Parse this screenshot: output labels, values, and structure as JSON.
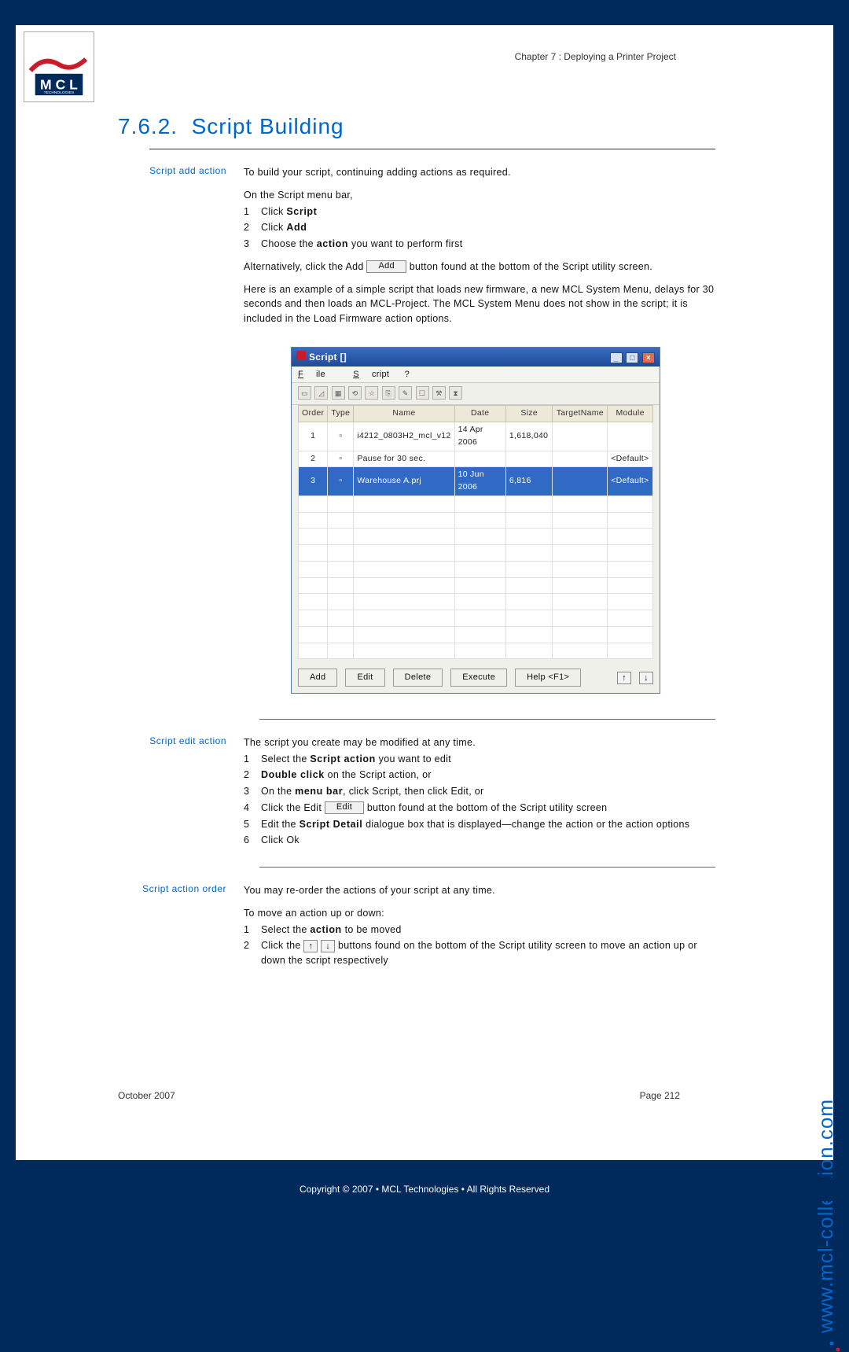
{
  "chapter": "Chapter 7 : Deploying a Printer Project",
  "heading_number": "7.6.2.",
  "heading_title": "Script Building",
  "section1": {
    "label": "Script add action",
    "intro": "To build your script, continuing adding actions as required.",
    "menu_intro": "On the Script menu bar,",
    "steps": [
      {
        "n": "1",
        "pre": "Click ",
        "bold": "Script"
      },
      {
        "n": "2",
        "pre": "Click ",
        "bold": "Add"
      },
      {
        "n": "3",
        "pre": "Choose the ",
        "bold": "action",
        "post": " you want to perform first"
      }
    ],
    "alt_pre": "Alternatively, click the Add ",
    "alt_btn": "Add",
    "alt_post": " button found at the bottom of the Script utility screen.",
    "example": "Here is an example of a simple script that loads new firmware, a new MCL System Menu, delays for 30 seconds and then loads an MCL-Project. The MCL System Menu does not show in the script; it is included in the Load Firmware action options."
  },
  "win": {
    "title": "Script []",
    "menu": {
      "file": "File",
      "script": "Script",
      "help": "?"
    },
    "columns": [
      "Order",
      "Type",
      "Name",
      "Date",
      "Size",
      "TargetName",
      "Module"
    ],
    "rows": [
      {
        "order": "1",
        "type": "fw",
        "name": "i4212_0803H2_mcl_v12",
        "date": "14 Apr 2006",
        "size": "1,618,040",
        "target": "",
        "module": ""
      },
      {
        "order": "2",
        "type": "wait",
        "name": "Pause for 30 sec.",
        "date": "",
        "size": "",
        "target": "",
        "module": "<Default>"
      },
      {
        "order": "3",
        "type": "prj",
        "name": "Warehouse A.prj",
        "date": "10 Jun 2006",
        "size": "6,816",
        "target": "",
        "module": "<Default>",
        "sel": true
      }
    ],
    "empty_rows": 10,
    "buttons": {
      "add": "Add",
      "edit": "Edit",
      "delete": "Delete",
      "execute": "Execute",
      "help": "Help <F1>"
    }
  },
  "section2": {
    "label": "Script edit action",
    "intro": "The script you create may be modified at any time.",
    "steps": [
      {
        "n": "1",
        "pre": "Select the ",
        "bold": "Script action",
        "post": " you want to edit"
      },
      {
        "n": "2",
        "bold": "Double click",
        "post": " on the Script action, or"
      },
      {
        "n": "3",
        "pre": "On the ",
        "bold": "menu bar",
        "post": ", click Script, then click Edit, or"
      },
      {
        "n": "4",
        "pre": "Click the Edit ",
        "btn": "Edit",
        "post": " button found at the bottom of the Script utility screen"
      },
      {
        "n": "5",
        "pre": "Edit the ",
        "bold": "Script Detail",
        "post": " dialogue box that is displayed—change the action or the action options"
      },
      {
        "n": "6",
        "pre": "Click Ok"
      }
    ]
  },
  "section3": {
    "label": "Script action order",
    "intro": "You may re-order the actions of your script at any time.",
    "sub": "To move an action up or down:",
    "steps": [
      {
        "n": "1",
        "pre": "Select the ",
        "bold": "action",
        "post": " to be moved"
      },
      {
        "n": "2",
        "pre": "Click the ",
        "arrows": true,
        "post": " buttons found on the bottom of the Script utility screen to move an action up or down the script respectively"
      }
    ]
  },
  "footer": {
    "left": "October 2007",
    "right": "Page 212"
  },
  "copyright": "Copyright © 2007 • MCL Technologies • All Rights Reserved",
  "side_url": "www.mcl-collection.com"
}
